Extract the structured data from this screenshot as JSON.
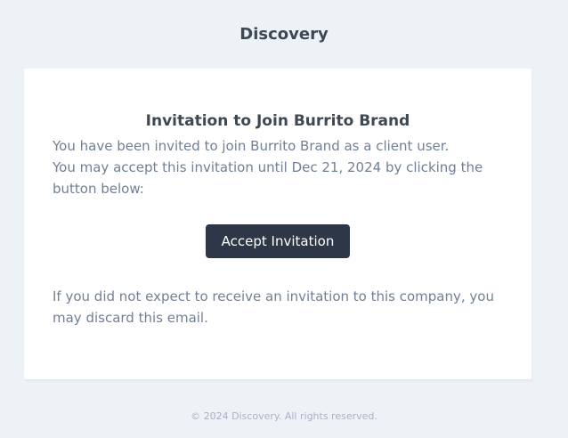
{
  "header": {
    "brand": "Discovery"
  },
  "card": {
    "title": "Invitation to Join Burrito Brand",
    "body_line1": "You have been invited to join Burrito Brand as a client user.",
    "body_line2": "You may accept this invitation until Dec 21, 2024 by clicking the button below:",
    "button_label": "Accept Invitation",
    "note": "If you did not expect to receive an invitation to this company, you may discard this email."
  },
  "footer": {
    "text": "© 2024 Discovery. All rights reserved."
  },
  "colors": {
    "background": "#edf2f7",
    "card": "#ffffff",
    "button": "#2d3748",
    "heading": "#3d4852",
    "body_text": "#718096",
    "footer_text": "#b0adc5"
  }
}
